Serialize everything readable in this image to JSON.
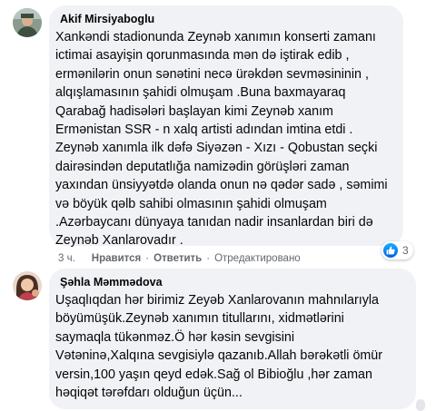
{
  "comments": [
    {
      "author": "Akif Mirsiyaboglu",
      "text": "Xankəndi stadionunda Zeynəb xanımın konserti zamanı\nictimai asayişin qorunmasında mən də iştirak edib ,\nermənilərin onun sənətini necə ürəkdən sevməsininin ,\nalqışlamasının şahidi olmuşam .Buna baxmayaraq\nQarabağ hadisələri başlayan kimi Zeynəb xanım\nErmənistan SSR - n xalq artisti adından imtina etdi .\nZeynəb xanımla ilk dəfə Siyəzən - Xızı - Qobustan seçki\ndairəsindən deputatlığa namizədin görüşləri zaman\nyaxından ünsiyyətdə olanda onun nə qədər sadə , səmimi\nvə böyük qəlb sahibi olmasının şahidi olmuşam\n.Azərbaycanı dünyaya tanıdan nadir insanlardan biri də\nZeynəb Xanlarovadır .",
      "time": "3 ч.",
      "like_label": "Нравится",
      "reply_label": "Ответить",
      "edited_label": "Отредактировано",
      "reaction_count": "3"
    },
    {
      "author": "Şəhla Məmmədova",
      "text": "Uşaqlıqdan hər birimiz Zeyəb Xanlarovanın mahnılarıyla\nböyümüşük.Zeynəb xanımın titullarını, xidmətlərini\nsaymaqla tükənməz.Ö hər kəsin sevgisini\nVətəninə,Xalqına sevgisiylə qazanıb.Allah bərəkətli ömür\nversin,100 yaşın qeyd edək.Sağ ol Bibioğlu ,hər zaman\nhəqiqət tərəfdarı olduğun üçün..."
    }
  ],
  "icons": {
    "like": "like-thumb-icon"
  },
  "colors": {
    "bubble": "#f0f2f5",
    "like_blue": "#1877f2",
    "meta_gray": "#65676b"
  }
}
